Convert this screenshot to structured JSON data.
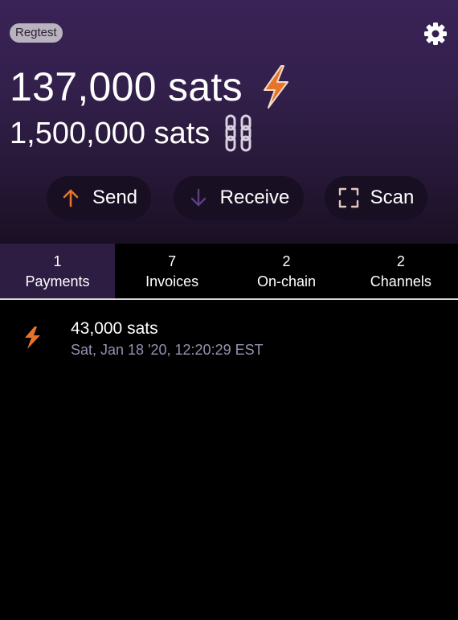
{
  "header": {
    "network_badge": "Regtest",
    "lightning_balance": "137,000 sats",
    "onchain_balance": "1,500,000 sats"
  },
  "actions": [
    {
      "label": "Send",
      "icon": "arrow-up-icon"
    },
    {
      "label": "Receive",
      "icon": "arrow-down-icon"
    },
    {
      "label": "Scan",
      "icon": "scan-frame-icon"
    }
  ],
  "tabs": [
    {
      "count": "1",
      "label": "Payments",
      "active": true
    },
    {
      "count": "7",
      "label": "Invoices",
      "active": false
    },
    {
      "count": "2",
      "label": "On-chain",
      "active": false
    },
    {
      "count": "2",
      "label": "Channels",
      "active": false
    }
  ],
  "payments": [
    {
      "icon": "lightning-bolt-icon",
      "amount": "43,000 sats",
      "date": "Sat, Jan 18 '20, 12:20:29 EST"
    }
  ],
  "colors": {
    "accent_orange": "#e8742a",
    "header_purple": "#3a2357",
    "active_tab": "#2d1d42",
    "muted_text": "#9a8fb1"
  }
}
